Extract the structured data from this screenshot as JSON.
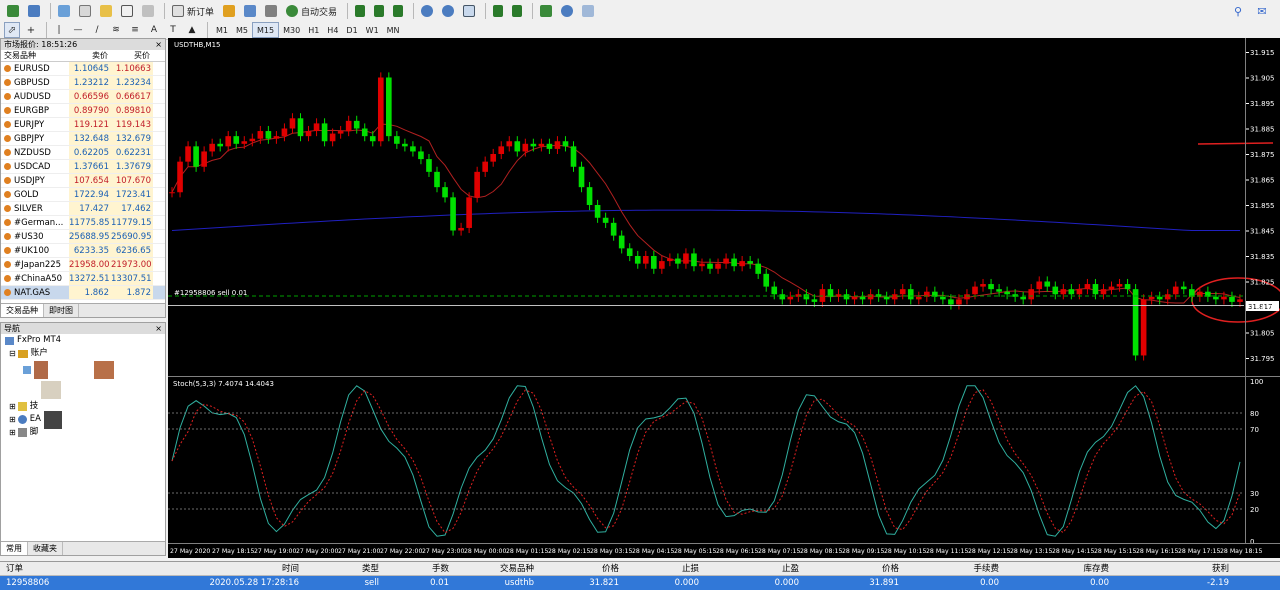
{
  "toolbar": {
    "new_order": "新订单",
    "auto_trading": "自动交易",
    "timeframes": [
      "M1",
      "M5",
      "M15",
      "M30",
      "H1",
      "H4",
      "D1",
      "W1",
      "MN"
    ],
    "active_timeframe": "M15"
  },
  "market_watch": {
    "title": "市场报价: 18:51:26",
    "columns": [
      "交易品种",
      "卖价",
      "买价"
    ],
    "rows": [
      {
        "symbol": "EURUSD",
        "bid": "1.10645",
        "ask": "1.10663",
        "bid_color": "#1a5fb4",
        "ask_color": "#c01c28"
      },
      {
        "symbol": "GBPUSD",
        "bid": "1.23212",
        "ask": "1.23234",
        "bid_color": "#1a5fb4",
        "ask_color": "#1a5fb4"
      },
      {
        "symbol": "AUDUSD",
        "bid": "0.66596",
        "ask": "0.66617",
        "bid_color": "#c01c28",
        "ask_color": "#c01c28"
      },
      {
        "symbol": "EURGBP",
        "bid": "0.89790",
        "ask": "0.89810",
        "bid_color": "#c01c28",
        "ask_color": "#c01c28"
      },
      {
        "symbol": "EURJPY",
        "bid": "119.121",
        "ask": "119.143",
        "bid_color": "#c01c28",
        "ask_color": "#c01c28"
      },
      {
        "symbol": "GBPJPY",
        "bid": "132.648",
        "ask": "132.679",
        "bid_color": "#1a5fb4",
        "ask_color": "#1a5fb4"
      },
      {
        "symbol": "NZDUSD",
        "bid": "0.62205",
        "ask": "0.62231",
        "bid_color": "#1a5fb4",
        "ask_color": "#1a5fb4"
      },
      {
        "symbol": "USDCAD",
        "bid": "1.37661",
        "ask": "1.37679",
        "bid_color": "#1a5fb4",
        "ask_color": "#1a5fb4"
      },
      {
        "symbol": "USDJPY",
        "bid": "107.654",
        "ask": "107.670",
        "bid_color": "#c01c28",
        "ask_color": "#c01c28"
      },
      {
        "symbol": "GOLD",
        "bid": "1722.94",
        "ask": "1723.41",
        "bid_color": "#1a5fb4",
        "ask_color": "#1a5fb4"
      },
      {
        "symbol": "SILVER",
        "bid": "17.427",
        "ask": "17.462",
        "bid_color": "#1a5fb4",
        "ask_color": "#1a5fb4"
      },
      {
        "symbol": "#German...",
        "bid": "11775.85",
        "ask": "11779.15",
        "bid_color": "#1a5fb4",
        "ask_color": "#1a5fb4"
      },
      {
        "symbol": "#US30",
        "bid": "25688.95",
        "ask": "25690.95",
        "bid_color": "#1a5fb4",
        "ask_color": "#1a5fb4"
      },
      {
        "symbol": "#UK100",
        "bid": "6233.35",
        "ask": "6236.65",
        "bid_color": "#1a5fb4",
        "ask_color": "#1a5fb4"
      },
      {
        "symbol": "#Japan225",
        "bid": "21958.00",
        "ask": "21973.00",
        "bid_color": "#c01c28",
        "ask_color": "#c01c28"
      },
      {
        "symbol": "#ChinaA50",
        "bid": "13272.51",
        "ask": "13307.51",
        "bid_color": "#1a5fb4",
        "ask_color": "#1a5fb4"
      },
      {
        "symbol": "NAT.GAS",
        "bid": "1.862",
        "ask": "1.872",
        "bid_color": "#1a5fb4",
        "ask_color": "#1a5fb4"
      }
    ],
    "tabs": [
      "交易品种",
      "即时图"
    ]
  },
  "navigator": {
    "title": "导航",
    "root": "FxPro MT4",
    "accounts": "账户",
    "items": [
      "技",
      "EA",
      "脚"
    ],
    "tabs": [
      "常用",
      "收藏夹"
    ]
  },
  "chart": {
    "title": "USDTHB,M15",
    "order_label": "#12958806 sell 0.01",
    "current_price": "31.817",
    "price_ticks": [
      "31.915",
      "31.905",
      "31.895",
      "31.885",
      "31.875",
      "31.865",
      "31.855",
      "31.845",
      "31.835",
      "31.825",
      "31.815",
      "31.805",
      "31.795"
    ],
    "stoch_label": "Stoch(5,3,3) 7.4074 14.4043",
    "stoch_ticks": [
      "100",
      "80",
      "70",
      "30",
      "20",
      "0"
    ],
    "time_ticks": [
      "27 May 2020",
      "27 May 18:15",
      "27 May 19:00",
      "27 May 20:00",
      "27 May 21:00",
      "27 May 22:00",
      "27 May 23:00",
      "28 May 00:00",
      "28 May 01:15",
      "28 May 02:15",
      "28 May 03:15",
      "28 May 04:15",
      "28 May 05:15",
      "28 May 06:15",
      "28 May 07:15",
      "28 May 08:15",
      "28 May 09:15",
      "28 May 10:15",
      "28 May 11:15",
      "28 May 12:15",
      "28 May 13:15",
      "28 May 14:15",
      "28 May 15:15",
      "28 May 16:15",
      "28 May 17:15",
      "28 May 18:15"
    ]
  },
  "terminal": {
    "columns": [
      "订单",
      "时间",
      "类型",
      "手数",
      "交易品种",
      "价格",
      "止损",
      "止盈",
      "价格",
      "手续费",
      "库存费",
      "获利"
    ],
    "row": [
      "12958806",
      "2020.05.28 17:28:16",
      "sell",
      "0.01",
      "usdthb",
      "31.821",
      "0.000",
      "0.000",
      "31.891",
      "0.00",
      "0.00",
      "-2.19"
    ]
  },
  "colors": {
    "bull": "#00e000",
    "bear": "#e00000",
    "ma_fast": "#b02020",
    "ma_slow": "#2020c0",
    "annotation": "#e02020"
  }
}
